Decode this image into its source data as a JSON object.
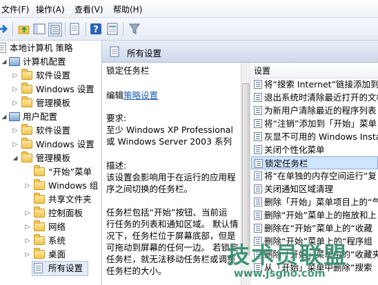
{
  "menubar": {
    "items": [
      "文件(F)",
      "操作(A)",
      "查看(V)",
      "帮助(H)"
    ]
  },
  "tree": {
    "root": "本地计算机 策略",
    "computer_config": "计算机配置",
    "user_config": "用户配置",
    "computer_children": [
      "软件设置",
      "Windows 设置",
      "管理模板"
    ],
    "user_children": [
      "软件设置",
      "Windows 设置",
      "管理模板"
    ],
    "admin_children": [
      "“开始”菜单",
      "Windows 组",
      "共享文件夹",
      "控制面板",
      "网络",
      "系统",
      "桌面",
      "所有设置"
    ]
  },
  "header": {
    "title": "所有设置"
  },
  "description": {
    "policy_title": "锁定任务栏",
    "edit_prefix": "编辑",
    "edit_link": "策略设置",
    "requirements_label": "要求:",
    "requirements_lines": [
      "至少 Windows XP Professional",
      "或 Windows Server 2003 系列"
    ],
    "desc_label": "描述:",
    "desc_lines": [
      "该设置会影响用于在运行的应用程",
      "序之间切换的任务栏。",
      "",
      "任务栏包括“开始”按钮、当前运",
      "行任务的列表和通知区域。 默认情",
      "况下，任务栏位于屏幕底部，但是",
      "可拖动到屏幕的任何一边。 若锁定",
      "任务栏，就无法移动任务栏或调整",
      "任务栏的大小。"
    ]
  },
  "list": {
    "column_header": "设置",
    "rows": [
      "将“搜索 Internet”链接添加到",
      "退出系统时清除最近打开的文档",
      "为新用户清除最近的程序列表",
      "将“注销”添加到「开始」菜单",
      "灰显不可用的 Windows Install",
      "关闭个性化菜单",
      "锁定任务栏",
      "将“在单独的内存空间运行”复",
      "关闭通知区域清理",
      "删除「开始」菜单项目上的“气",
      "删除“开始”菜单上的拖放和上",
      "删除在“开始”菜单上的“收藏",
      "删除“开始”菜单上的“程序组",
      "删除「开始」菜单中的“收藏夹",
      "从「开始」菜单中删除“搜索"
    ],
    "selected_index": 6
  },
  "watermark": {
    "line1": "技术员联盟",
    "line2": "www.jsgho.com"
  },
  "colors": {
    "selection": "#cfe5ff",
    "link": "#1e5fb7",
    "watermark": "#2f8a6a"
  }
}
